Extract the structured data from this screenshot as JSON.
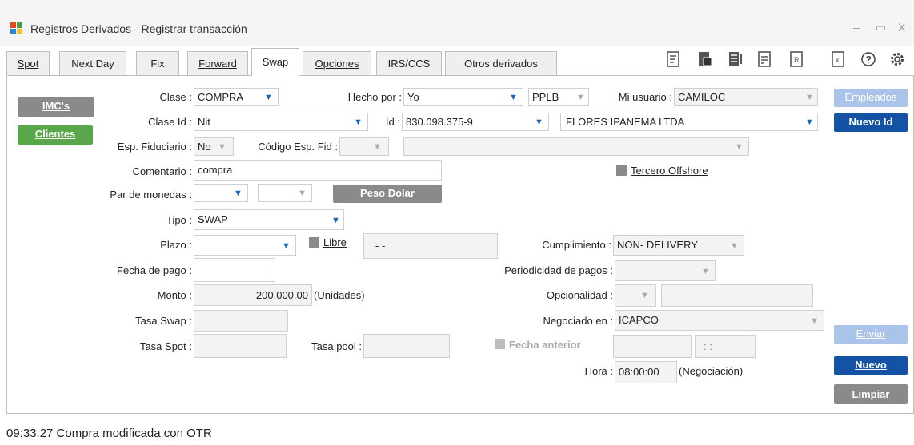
{
  "window": {
    "title": "Registros Derivados - Registrar transacción",
    "minimize": "–",
    "maximize": "▭",
    "close": "X"
  },
  "tabs": [
    {
      "label": "Spot"
    },
    {
      "label": "Next Day"
    },
    {
      "label": "Fix"
    },
    {
      "label": "Forward"
    },
    {
      "label": "Swap",
      "active": true
    },
    {
      "label": "Opciones"
    },
    {
      "label": "IRS/CCS"
    },
    {
      "label": "Otros derivados"
    }
  ],
  "toolbar_icons": [
    "document-edit-icon",
    "database-icon",
    "list-document-icon",
    "calculator-document-icon",
    "r-icon",
    "excel-icon",
    "help-icon",
    "gear-icon"
  ],
  "side_buttons": {
    "imcs": "IMC's",
    "clientes": "Clientes",
    "empleados": "Empleados",
    "nuevo_id": "Nuevo Id",
    "enviar": "Enviar",
    "nuevo": "Nuevo",
    "limpiar": "Limpiar"
  },
  "form": {
    "clase_label": "Clase :",
    "clase_value": "COMPRA",
    "hecho_por_label": "Hecho por :",
    "hecho_por_value": "Yo",
    "hecho_por_code": "PPLB",
    "mi_usuario_label": "Mi usuario :",
    "mi_usuario_value": "CAMILOC",
    "clase_id_label": "Clase Id :",
    "clase_id_value": "Nit",
    "id_label": "Id :",
    "id_value": "830.098.375-9",
    "id_name": "FLORES IPANEMA LTDA",
    "esp_fiduciario_label": "Esp. Fiduciario :",
    "esp_fiduciario_value": "No",
    "codigo_esp_fid_label": "Código Esp. Fid :",
    "codigo_esp_fid_value": "",
    "comentario_label": "Comentario :",
    "comentario_value": "compra",
    "tercero_offshore_label": "Tercero Offshore",
    "par_monedas_label": "Par de monedas :",
    "peso_dolar_button": "Peso Dolar",
    "tipo_label": "Tipo :",
    "tipo_value": "SWAP",
    "plazo_label": "Plazo :",
    "libre_label": "Libre",
    "libre_value": "-  -",
    "cumplimiento_label": "Cumplimiento :",
    "cumplimiento_value": "NON- DELIVERY",
    "fecha_pago_label": "Fecha de pago :",
    "periodicidad_label": "Periodicidad de pagos :",
    "monto_label": "Monto :",
    "monto_value": "200,000.00",
    "monto_unit": "(Unidades)",
    "opcionalidad_label": "Opcionalidad :",
    "tasa_swap_label": "Tasa Swap :",
    "negociado_en_label": "Negociado en :",
    "negociado_en_value": "ICAPCO",
    "tasa_spot_label": "Tasa Spot :",
    "tasa_pool_label": "Tasa pool :",
    "fecha_anterior_label": "Fecha anterior",
    "fecha_anterior_time": ": :",
    "hora_label": "Hora :",
    "hora_value": "08:00:00",
    "hora_note": "(Negociación)"
  },
  "status_message": "09:33:27 Compra modificada con  OTR",
  "colors": {
    "accent_blue": "#1452a5",
    "green": "#5aa64a",
    "gray": "#8a8a8a",
    "dropdown_arrow": "#1565c0"
  }
}
